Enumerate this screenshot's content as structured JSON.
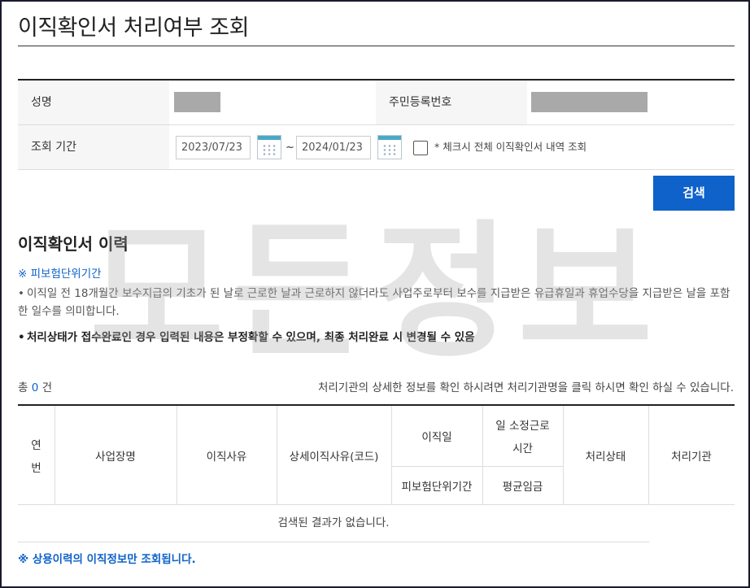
{
  "page": {
    "title": "이직확인서 처리여부 조회"
  },
  "form": {
    "name_label": "성명",
    "rrn_label": "주민등록번호",
    "period_label": "조회 기간",
    "date_from": "2023/07/23",
    "date_to": "2024/01/23",
    "tilde": "~",
    "check_all_label": "* 체크시 전체 이직확인서 내역 조회",
    "check_all_checked": false,
    "search_button": "검색"
  },
  "history": {
    "section_title": "이직확인서 이력",
    "note_heading": "※ 피보험단위기간",
    "bullet1": "이직일 전 18개월간 보수지급의 기초가 된 날로 근로한 날과 근로하지 않더라도 사업주로부터 보수를 지급받은 유급휴일과 휴업수당을 지급받은 날을 포함한 일수를 의미합니다.",
    "bullet2": "처리상태가 접수완료인 경우 입력된 내용은 부정확할 수 있으며, 최종 처리완료 시 변경될 수 있음",
    "count_prefix": "총",
    "count_value": "0",
    "count_suffix": "건",
    "info_text": "처리기관의 상세한 정보를 확인 하시려면 처리기관명을 클릭 하시면 확인 하실 수 있습니다."
  },
  "table": {
    "headers": {
      "seq_1": "연",
      "seq_2": "번",
      "workplace": "사업장명",
      "reason": "이직사유",
      "detail_reason": "상세이직사유(코드)",
      "leave_date": "이직일",
      "insured_period": "피보험단위기간",
      "daily_hours_1": "일 소정근로",
      "daily_hours_2": "시간",
      "avg_wage": "평균임금",
      "status": "처리상태",
      "agency": "처리기관"
    },
    "empty_message": "검색된 결과가 없습니다."
  },
  "footer_note": "※ 상용이력의 이직정보만 조회됩니다.",
  "watermark": "모든정보",
  "colors": {
    "accent": "#0e62c9",
    "label_bg": "#f6f6f6",
    "mask": "#a9a9a9"
  }
}
